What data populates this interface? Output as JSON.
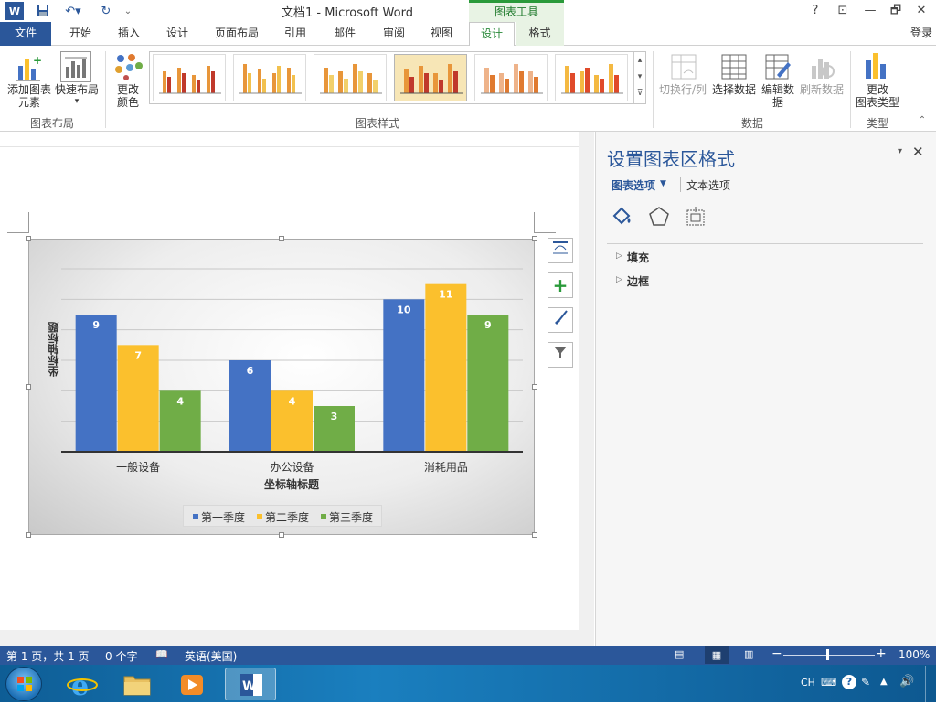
{
  "titlebar": {
    "doc_title": "文档1 - Microsoft Word",
    "context_group": "图表工具",
    "help": "?",
    "minimize": "—",
    "restore": "🗗",
    "close": "✕"
  },
  "tabs": {
    "file": "文件",
    "home": "开始",
    "insert": "插入",
    "design_doc": "设计",
    "layout": "页面布局",
    "references": "引用",
    "mailings": "邮件",
    "review": "审阅",
    "view": "视图",
    "design": "设计",
    "format": "格式",
    "login": "登录"
  },
  "ribbon": {
    "add_element_1": "添加图表",
    "add_element_2": "元素",
    "quick_layout": "快速布局",
    "change_color_1": "更改",
    "change_color_2": "颜色",
    "group_layout": "图表布局",
    "group_styles": "图表样式",
    "switch_row_col": "切换行/列",
    "select_data": "选择数据",
    "edit_data_1": "编辑数",
    "edit_data_2": "据",
    "refresh_data": "刷新数据",
    "group_data": "数据",
    "change_type_1": "更改",
    "change_type_2": "图表类型",
    "group_type": "类型"
  },
  "chart_data": {
    "type": "bar",
    "categories": [
      "一般设备",
      "办公设备",
      "消耗用品"
    ],
    "series": [
      {
        "name": "第一季度",
        "values": [
          9,
          6,
          10
        ],
        "color": "#4472c4"
      },
      {
        "name": "第二季度",
        "values": [
          7,
          4,
          11
        ],
        "color": "#fbc02d"
      },
      {
        "name": "第三季度",
        "values": [
          4,
          3,
          9
        ],
        "color": "#70ad47"
      }
    ],
    "ylim": [
      0,
      12
    ],
    "xlabel": "坐标轴标题",
    "ylabel": "坐标轴标题",
    "legend_position": "bottom",
    "grid": true
  },
  "pane": {
    "title": "设置图表区格式",
    "chart_options": "图表选项",
    "text_options": "文本选项",
    "fill": "填充",
    "border": "边框"
  },
  "status": {
    "page": "第 1 页，共 1 页",
    "words": "0 个字",
    "language": "英语(美国)",
    "zoom": "100%"
  },
  "tray": {
    "ime": "CH"
  }
}
